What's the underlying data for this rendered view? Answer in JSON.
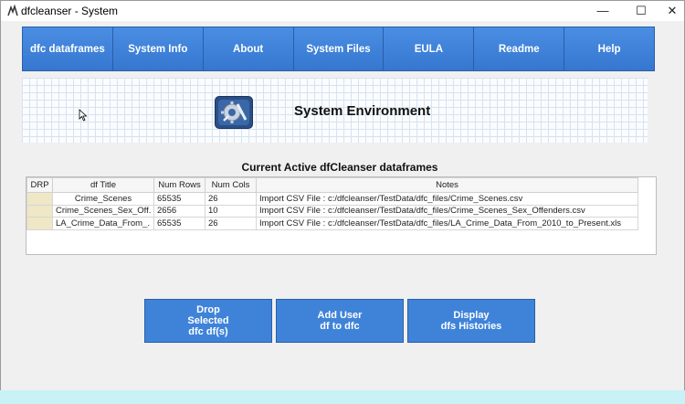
{
  "window": {
    "title": "dfcleanser - System",
    "controls": {
      "minimize": "—",
      "maximize": "☐",
      "close": "✕"
    }
  },
  "nav": {
    "items": [
      "dfc dataframes",
      "System Info",
      "About",
      "System Files",
      "EULA",
      "Readme",
      "Help"
    ]
  },
  "banner": {
    "title": "System Environment",
    "icon": "gear-tools-icon"
  },
  "section": {
    "title": "Current Active dfCleanser dataframes"
  },
  "table": {
    "headers": [
      "DRP",
      "df Title",
      "Num Rows",
      "Num Cols",
      "Notes"
    ],
    "rows": [
      {
        "drp": "",
        "title": "Crime_Scenes",
        "rows": "65535",
        "cols": "26",
        "notes": "Import CSV File : c:/dfcleanser/TestData/dfc_files/Crime_Scenes.csv"
      },
      {
        "drp": "",
        "title": "Crime_Scenes_Sex_Off...",
        "rows": "2656",
        "cols": "10",
        "notes": "Import CSV File : c:/dfcleanser/TestData/dfc_files/Crime_Scenes_Sex_Offenders.csv"
      },
      {
        "drp": "",
        "title": "LA_Crime_Data_From_...",
        "rows": "65535",
        "cols": "26",
        "notes": "Import CSV File : c:/dfcleanser/TestData/dfc_files/LA_Crime_Data_From_2010_to_Present.xls"
      }
    ]
  },
  "actions": {
    "drop": "Drop\nSelected\ndfc df(s)",
    "add": "Add User\ndf to dfc",
    "histories": "Display\ndfs Histories"
  },
  "colors": {
    "nav_blue": "#3f83d9",
    "drp_cell": "#efe7c6",
    "status_strip": "#c8f2f5"
  }
}
